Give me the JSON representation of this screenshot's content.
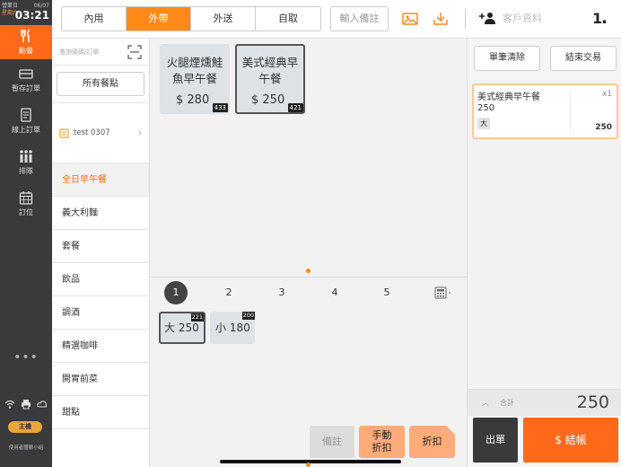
{
  "status": {
    "label1": "營業日",
    "label2": "星期六",
    "date": "06/07",
    "time": "03:21"
  },
  "sidebar": {
    "items": [
      {
        "label": "點餐",
        "icon": "utensils-icon",
        "active": true
      },
      {
        "label": "暫存訂單",
        "icon": "tray-icon"
      },
      {
        "label": "線上訂單",
        "icon": "document-icon"
      },
      {
        "label": "排隊",
        "icon": "queue-icon"
      },
      {
        "label": "訂位",
        "icon": "calendar-icon"
      }
    ],
    "more": "•••",
    "host_badge": "主機",
    "user_text": "使用者體驗小組"
  },
  "topbar": {
    "modes": [
      "內用",
      "外帶",
      "外送",
      "自取"
    ],
    "active_mode": "外帶",
    "note_button": "輸入備註",
    "customer_placeholder": "客戶資料",
    "guest_count": "1"
  },
  "categories": {
    "search_placeholder": "查詢條碼/訂單",
    "all_items_button": "所有餐點",
    "test_entry": "test 0307",
    "list": [
      "全日早午餐",
      "義大利麵",
      "套餐",
      "飲品",
      "調酒",
      "精選咖啡",
      "開胃前菜",
      "甜點"
    ],
    "active": "全日早午餐"
  },
  "products": [
    {
      "name": "火腿煙燻鮭魚早午餐",
      "price": "$ 280",
      "stock": "433"
    },
    {
      "name": "美式經典早午餐",
      "price": "$ 250",
      "stock": "421",
      "selected": true
    }
  ],
  "pager": {
    "pages": [
      "1",
      "2",
      "3",
      "4",
      "5"
    ],
    "current": "1"
  },
  "options": [
    {
      "label": "大 250",
      "stock": "221",
      "selected": true
    },
    {
      "label": "小 180",
      "stock": "200"
    }
  ],
  "actions": {
    "note": "備註",
    "manual_discount": "手動折扣",
    "discount": "折扣"
  },
  "order": {
    "clear_button": "單筆清除",
    "end_button": "結束交易",
    "items": [
      {
        "name": "美式經典早午餐",
        "qty": "x1",
        "unit_price": "250",
        "size": "大",
        "total": "250"
      }
    ],
    "subtotal_label": "合計",
    "subtotal": "250",
    "print_button": "出單",
    "checkout_button": "$ 結帳"
  },
  "colors": {
    "accent": "#ff6a1a",
    "sidebar": "#3a3a3c",
    "tile": "#dde2e6"
  }
}
